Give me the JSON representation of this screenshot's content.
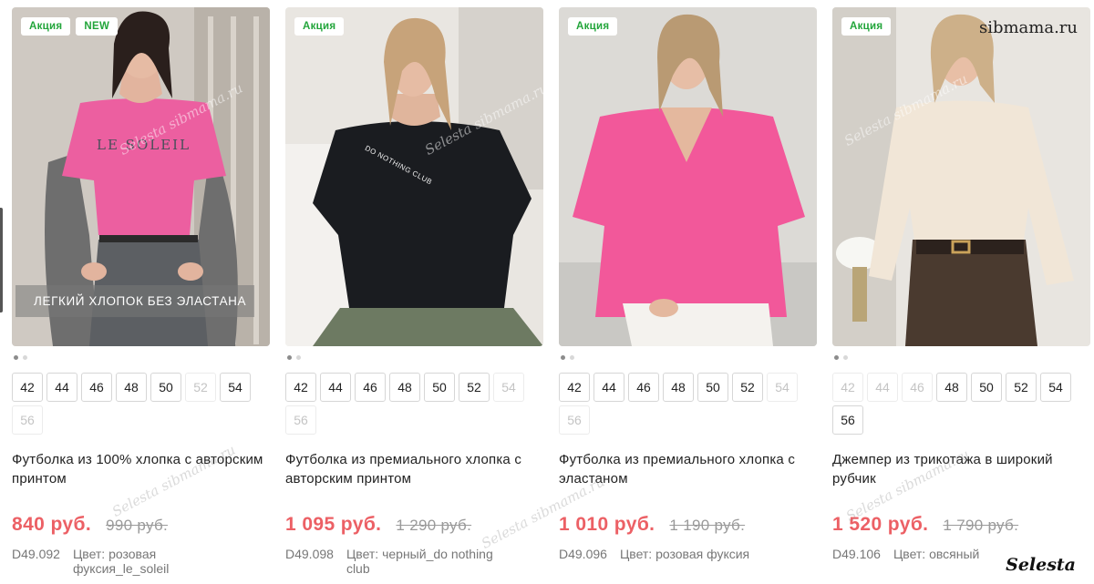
{
  "watermarks": {
    "site": "sibmama.ru",
    "brand": "Selesta",
    "diagonal": "Selesta sibmama.ru"
  },
  "colors": {
    "accent_price": "#ec6065",
    "badge_text": "#22a53a",
    "old_price": "#9a9a9a"
  },
  "products": [
    {
      "badges": [
        "Акция",
        "NEW"
      ],
      "photo_caption": "ЛЕГКИЙ ХЛОПОК БЕЗ ЭЛАСТАНА",
      "shirt_print": "LE SOLEIL",
      "sizes": [
        {
          "label": "42",
          "available": true
        },
        {
          "label": "44",
          "available": true
        },
        {
          "label": "46",
          "available": true
        },
        {
          "label": "48",
          "available": true
        },
        {
          "label": "50",
          "available": true
        },
        {
          "label": "52",
          "available": false
        },
        {
          "label": "54",
          "available": true
        },
        {
          "label": "56",
          "available": false
        }
      ],
      "title": "Футболка из 100% хлопка с авторским принтом",
      "price": "840 руб.",
      "old_price": "990 руб.",
      "sku": "D49.092",
      "color": "Цвет: розовая фуксия_le_soleil"
    },
    {
      "badges": [
        "Акция"
      ],
      "shirt_print": "DO NOTHING CLUB",
      "sizes": [
        {
          "label": "42",
          "available": true
        },
        {
          "label": "44",
          "available": true
        },
        {
          "label": "46",
          "available": true
        },
        {
          "label": "48",
          "available": true
        },
        {
          "label": "50",
          "available": true
        },
        {
          "label": "52",
          "available": true
        },
        {
          "label": "54",
          "available": false
        },
        {
          "label": "56",
          "available": false
        }
      ],
      "title": "Футболка из премиального хлопка с авторским принтом",
      "price": "1 095 руб.",
      "old_price": "1 290 руб.",
      "sku": "D49.098",
      "color": "Цвет: черный_do nothing club"
    },
    {
      "badges": [
        "Акция"
      ],
      "sizes": [
        {
          "label": "42",
          "available": true
        },
        {
          "label": "44",
          "available": true
        },
        {
          "label": "46",
          "available": true
        },
        {
          "label": "48",
          "available": true
        },
        {
          "label": "50",
          "available": true
        },
        {
          "label": "52",
          "available": true
        },
        {
          "label": "54",
          "available": false
        },
        {
          "label": "56",
          "available": false
        }
      ],
      "title": "Футболка из премиального хлопка с эластаном",
      "price": "1 010 руб.",
      "old_price": "1 190 руб.",
      "sku": "D49.096",
      "color": "Цвет: розовая фуксия"
    },
    {
      "badges": [
        "Акция"
      ],
      "sizes": [
        {
          "label": "42",
          "available": false
        },
        {
          "label": "44",
          "available": false
        },
        {
          "label": "46",
          "available": false
        },
        {
          "label": "48",
          "available": true
        },
        {
          "label": "50",
          "available": true
        },
        {
          "label": "52",
          "available": true
        },
        {
          "label": "54",
          "available": true
        },
        {
          "label": "56",
          "available": true
        }
      ],
      "title": "Джемпер из трикотажа в широкий рубчик",
      "price": "1 520 руб.",
      "old_price": "1 790 руб.",
      "sku": "D49.106",
      "color": "Цвет: овсяный"
    }
  ]
}
